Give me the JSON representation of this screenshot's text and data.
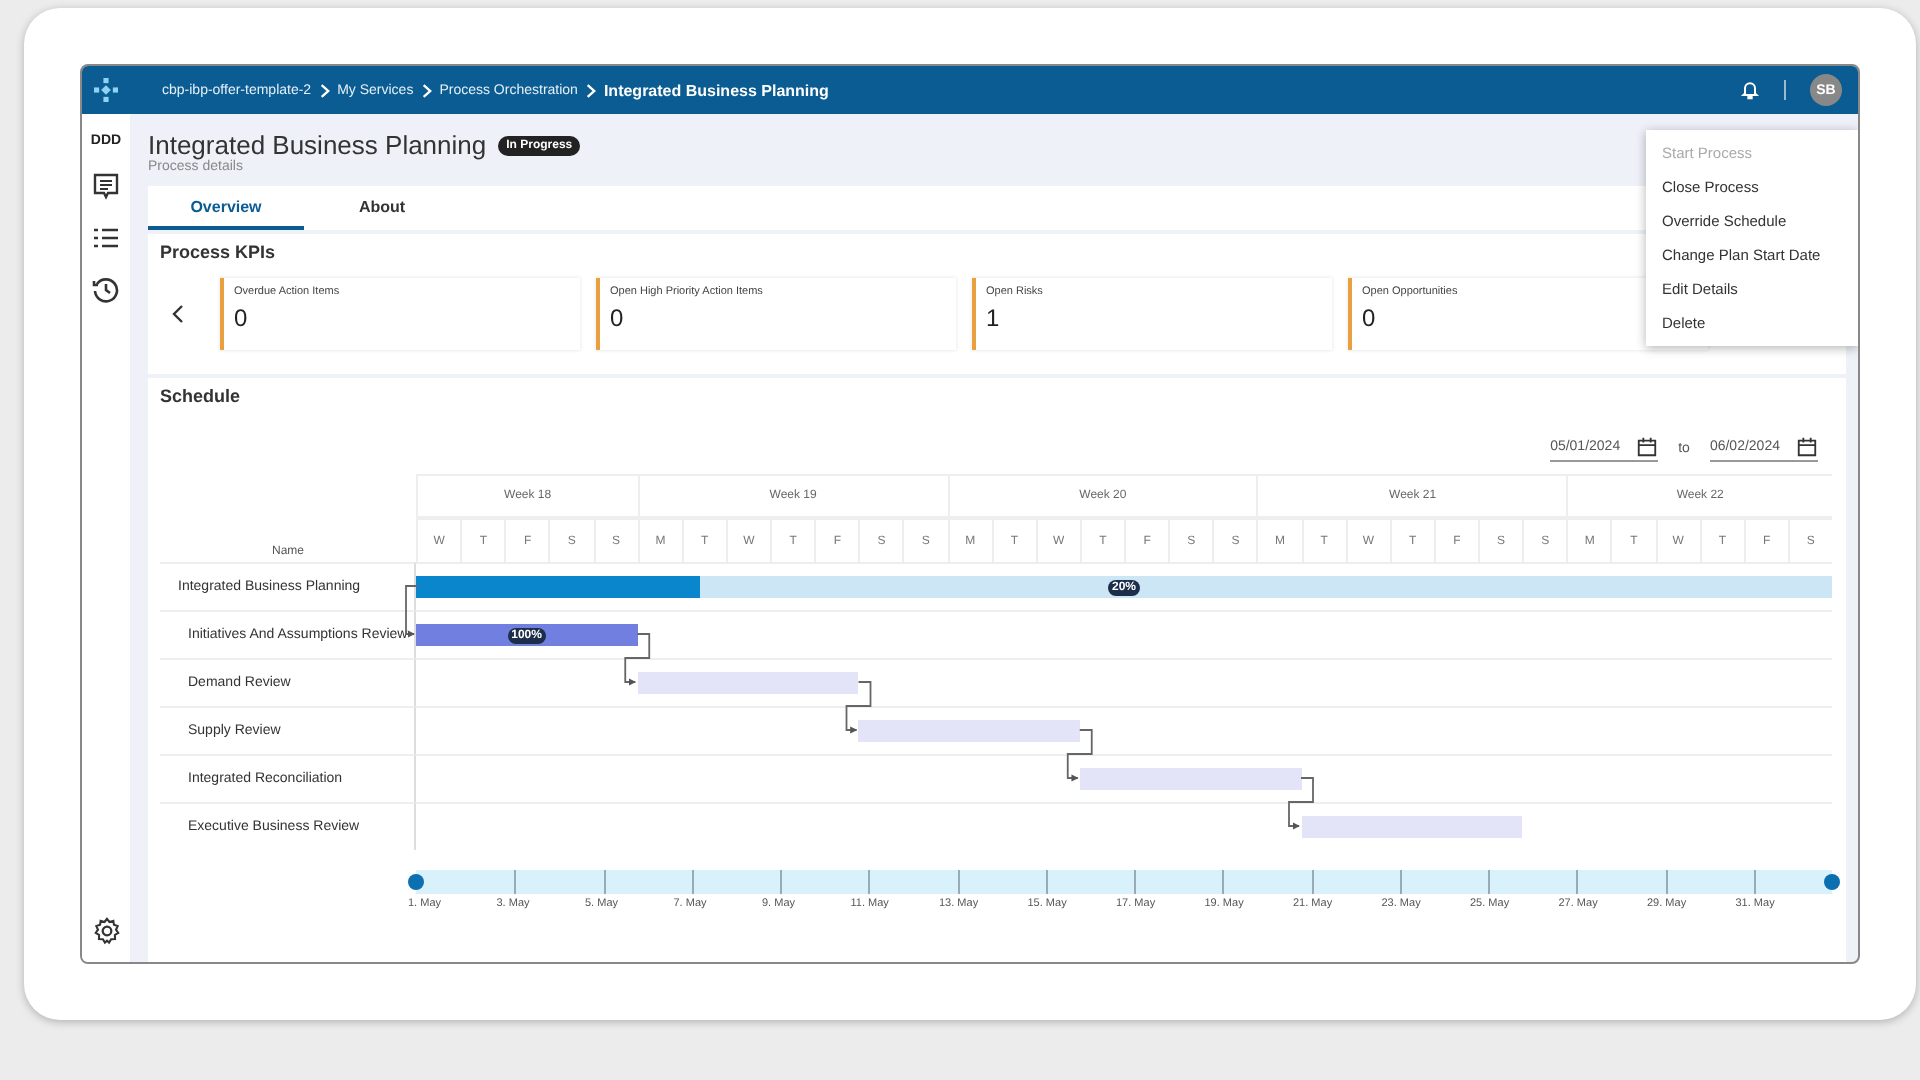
{
  "topbar": {
    "breadcrumbs": [
      {
        "label": "cbp-ibp-offer-template-2",
        "current": false
      },
      {
        "label": "My Services",
        "current": false
      },
      {
        "label": "Process Orchestration",
        "current": false
      },
      {
        "label": "Integrated Business Planning",
        "current": true
      }
    ],
    "avatar": "SB"
  },
  "sidebar": {
    "workspace": "DDD"
  },
  "header": {
    "title": "Integrated Business Planning",
    "status": "In Progress",
    "subtitle": "Process details"
  },
  "tabs": [
    {
      "label": "Overview",
      "selected": true
    },
    {
      "label": "About",
      "selected": false
    }
  ],
  "kpis": {
    "title": "Process KPIs",
    "cards": [
      {
        "label": "Overdue Action Items",
        "value": "0"
      },
      {
        "label": "Open High Priority Action Items",
        "value": "0"
      },
      {
        "label": "Open Risks",
        "value": "1"
      },
      {
        "label": "Open Opportunities",
        "value": "0"
      }
    ]
  },
  "menu": [
    {
      "label": "Start Process",
      "disabled": true
    },
    {
      "label": "Close Process",
      "disabled": false
    },
    {
      "label": "Override Schedule",
      "disabled": false
    },
    {
      "label": "Change Plan Start Date",
      "disabled": false
    },
    {
      "label": "Edit Details",
      "disabled": false
    },
    {
      "label": "Delete",
      "disabled": false
    }
  ],
  "schedule": {
    "title": "Schedule",
    "date_from": "05/01/2024",
    "to_label": "to",
    "date_to": "06/02/2024",
    "name_header": "Name",
    "weeks": [
      {
        "label": "Week 18",
        "days": [
          "W",
          "T",
          "F",
          "S",
          "S"
        ]
      },
      {
        "label": "Week 19",
        "days": [
          "M",
          "T",
          "W",
          "T",
          "F",
          "S",
          "S"
        ]
      },
      {
        "label": "Week 20",
        "days": [
          "M",
          "T",
          "W",
          "T",
          "F",
          "S",
          "S"
        ]
      },
      {
        "label": "Week 21",
        "days": [
          "M",
          "T",
          "W",
          "T",
          "F",
          "S",
          "S"
        ]
      },
      {
        "label": "Week 22",
        "days": [
          "M",
          "T",
          "W",
          "T",
          "F",
          "S"
        ]
      }
    ],
    "tasks": [
      {
        "name": "Integrated Business Planning",
        "kind": "summary",
        "level": 0.2,
        "progress_label": "20%"
      },
      {
        "name": "Initiatives And Assumptions Review",
        "kind": "task",
        "level": 1,
        "progress_label": "100%"
      },
      {
        "name": "Demand Review",
        "kind": "task",
        "level": 0
      },
      {
        "name": "Supply Review",
        "kind": "task",
        "level": 0
      },
      {
        "name": "Integrated Reconciliation",
        "kind": "task",
        "level": 0
      },
      {
        "name": "Executive Business Review",
        "kind": "task",
        "level": 0
      }
    ],
    "timeline_labels": [
      "1. May",
      "3. May",
      "5. May",
      "7. May",
      "9. May",
      "11. May",
      "13. May",
      "15. May",
      "17. May",
      "19. May",
      "21. May",
      "23. May",
      "25. May",
      "27. May",
      "29. May",
      "31. May"
    ]
  }
}
